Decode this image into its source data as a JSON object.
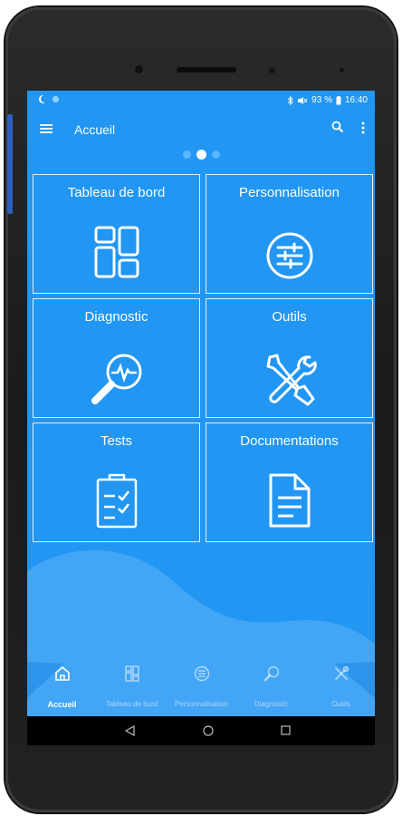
{
  "status_bar": {
    "right_text": "93 %",
    "time": "16:40"
  },
  "appbar": {
    "title": "Accueil"
  },
  "pager": {
    "pages": 3,
    "active_index": 1
  },
  "tiles": [
    {
      "label": "Tableau de bord",
      "icon": "dashboard-icon"
    },
    {
      "label": "Personnalisation",
      "icon": "tune-icon"
    },
    {
      "label": "Diagnostic",
      "icon": "diagnostic-icon"
    },
    {
      "label": "Outils",
      "icon": "tools-icon"
    },
    {
      "label": "Tests",
      "icon": "checklist-icon"
    },
    {
      "label": "Documentations",
      "icon": "document-icon"
    }
  ],
  "bottom_nav": [
    {
      "label": "Accueil",
      "icon": "home-icon",
      "active": true
    },
    {
      "label": "Tableau de bord",
      "icon": "dashboard-icon",
      "active": false
    },
    {
      "label": "Personnalisation",
      "icon": "tune-icon",
      "active": false
    },
    {
      "label": "Diagnostic",
      "icon": "diagnostic-icon",
      "active": false
    },
    {
      "label": "Outils",
      "icon": "tools-icon",
      "active": false
    }
  ],
  "colors": {
    "primary": "#2196f3",
    "wave_light": "#42a5f5",
    "white": "#ffffff"
  }
}
